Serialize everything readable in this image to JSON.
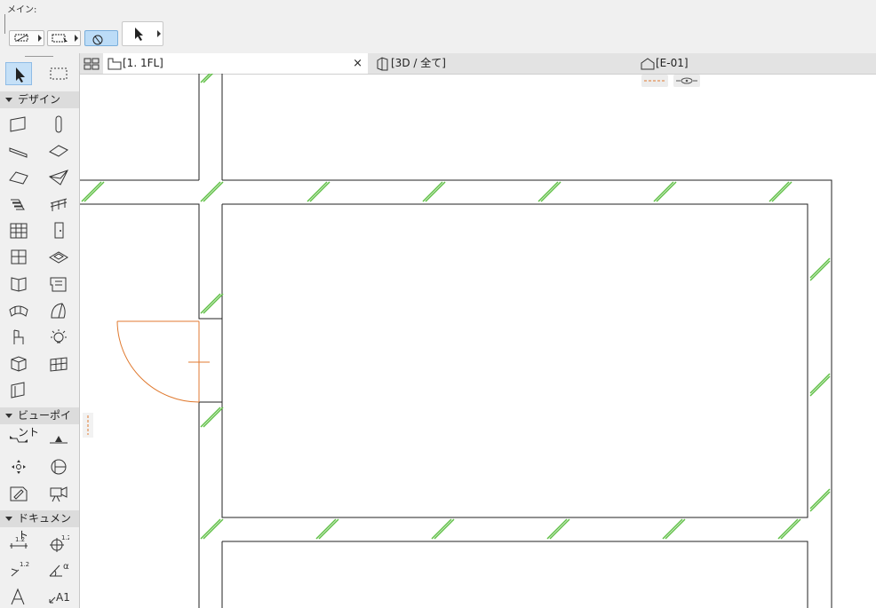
{
  "toolbar": {
    "title": "メイン:"
  },
  "tabs": [
    {
      "label": "[1. 1FL]",
      "close": "×"
    },
    {
      "label": "[3D / 全て]"
    },
    {
      "label": "[E-01]"
    }
  ],
  "sidebar": {
    "sections": [
      {
        "label": "デザイン"
      },
      {
        "label": "ビューポイント"
      },
      {
        "label": "ドキュメント"
      }
    ]
  },
  "colors": {
    "wall_hatch": "#5fbf45",
    "door": "#e07a30",
    "selection": "#c5e0f7"
  }
}
